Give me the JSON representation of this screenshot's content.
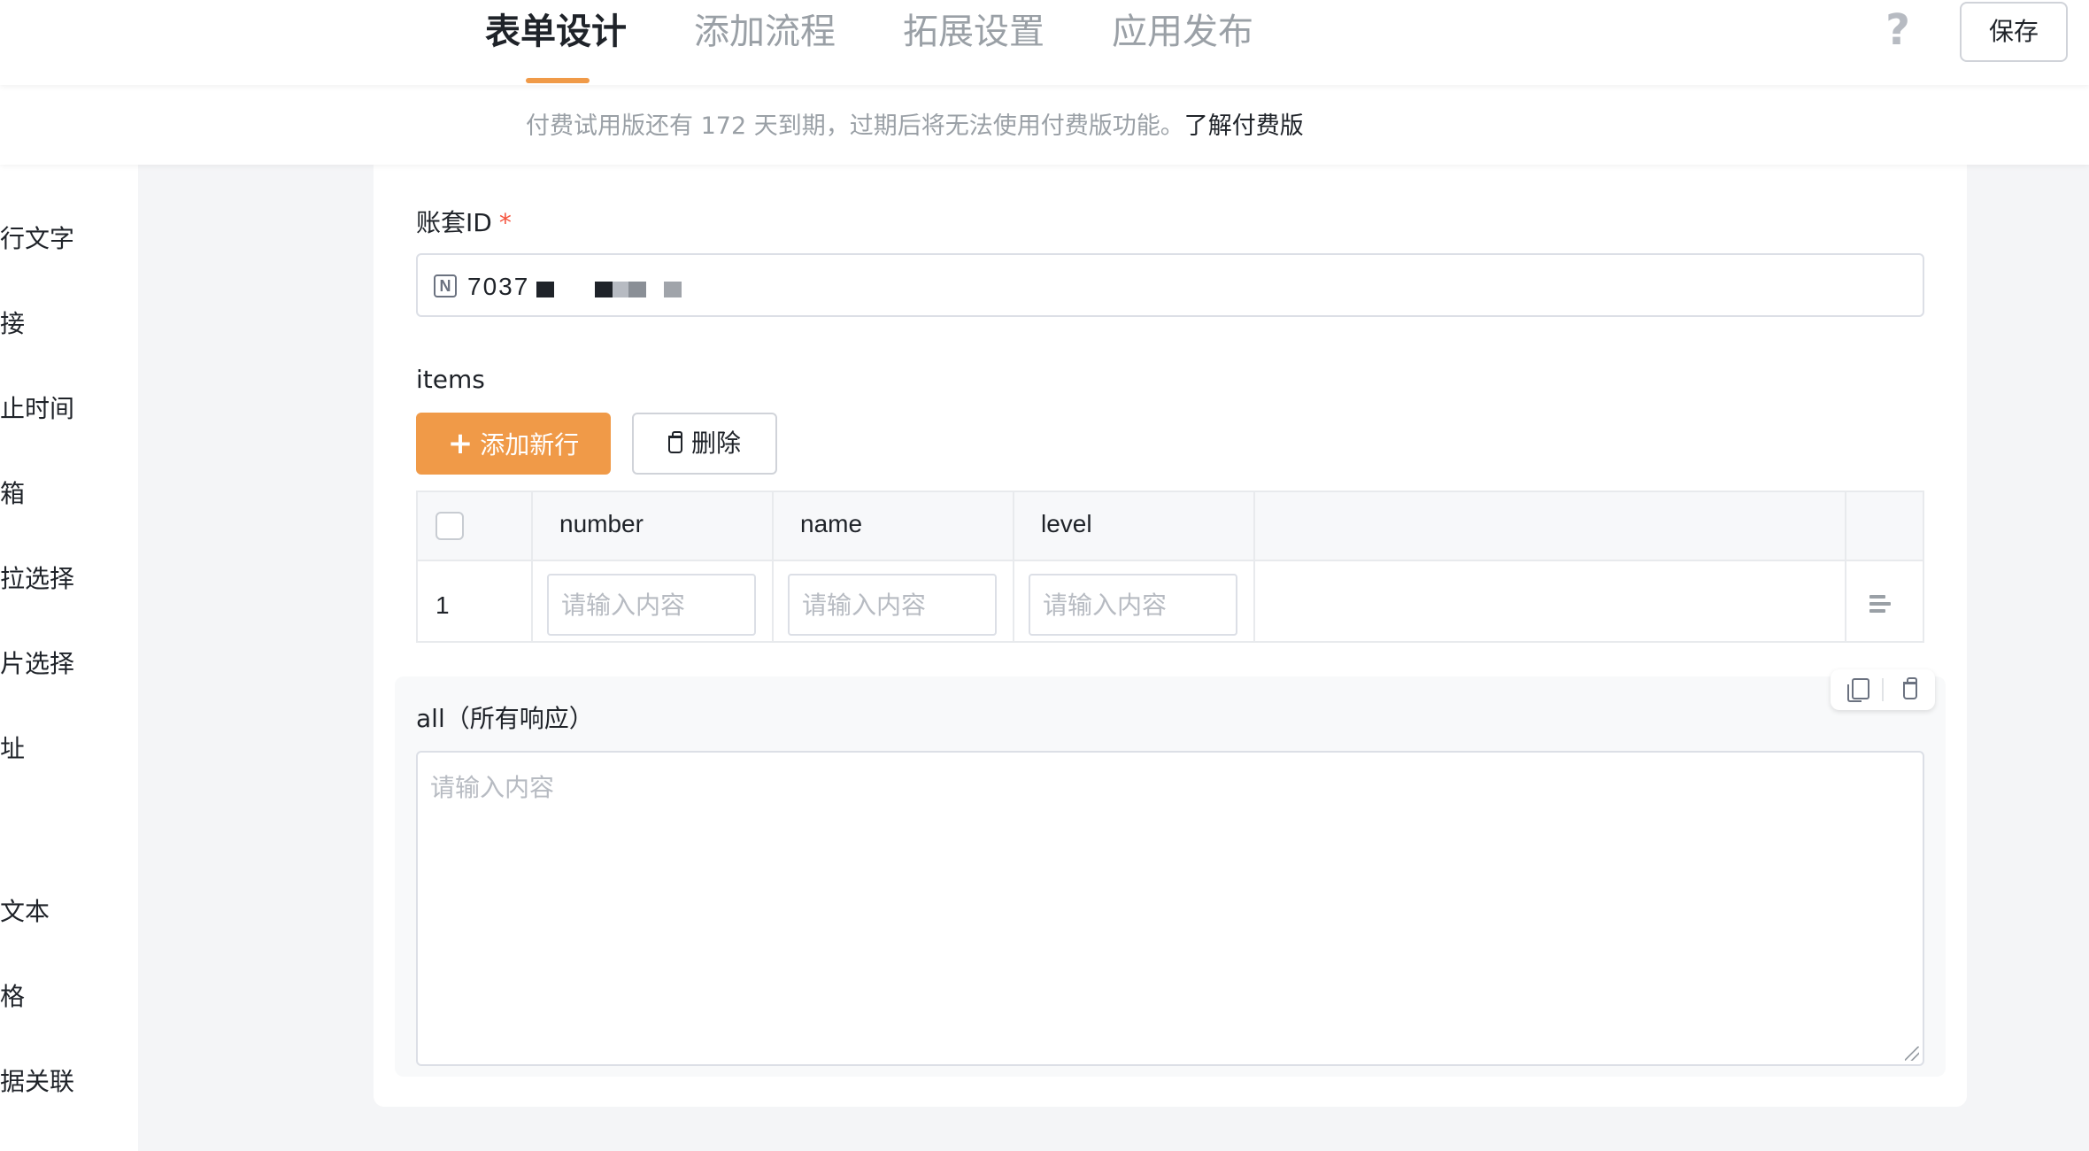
{
  "header": {
    "tabs": [
      {
        "label": "表单设计",
        "active": true
      },
      {
        "label": "添加流程",
        "active": false
      },
      {
        "label": "拓展设置",
        "active": false
      },
      {
        "label": "应用发布",
        "active": false
      }
    ],
    "help_icon": "question-mark-icon",
    "save_label": "保存"
  },
  "notice": {
    "text": "付费试用版还有 172 天到期，过期后将无法使用付费版功能。",
    "link": "了解付费版"
  },
  "sidebar": {
    "items": [
      {
        "label": "多行文字"
      },
      {
        "label": "链接"
      },
      {
        "label": "起止时间"
      },
      {
        "label": "邮箱"
      },
      {
        "label": "下拉选择"
      },
      {
        "label": "图片选择"
      },
      {
        "label": "地址"
      },
      {
        "label": "富文本"
      },
      {
        "label": "表格"
      },
      {
        "label": "数据关联"
      }
    ]
  },
  "form": {
    "account_id": {
      "label": "账套ID",
      "required_mark": "*",
      "value": "7037",
      "prefix_icon": "n-letter-icon"
    },
    "items": {
      "label": "items",
      "add_row_label": "添加新行",
      "delete_label": "删除",
      "columns": [
        "number",
        "name",
        "level"
      ],
      "rows": [
        {
          "index": "1",
          "number": "",
          "name": "",
          "level": ""
        }
      ],
      "cell_placeholder": "请输入内容",
      "row_action_icon": "row-insert-icon"
    },
    "all": {
      "label": "all（所有响应）",
      "placeholder": "请输入内容",
      "tool_icons": [
        "copy-icon",
        "trash-icon"
      ]
    }
  },
  "colors": {
    "accent": "#f09a48",
    "required": "#f5533d",
    "muted_text": "#9aa0a6",
    "border": "#dcdfe6"
  }
}
